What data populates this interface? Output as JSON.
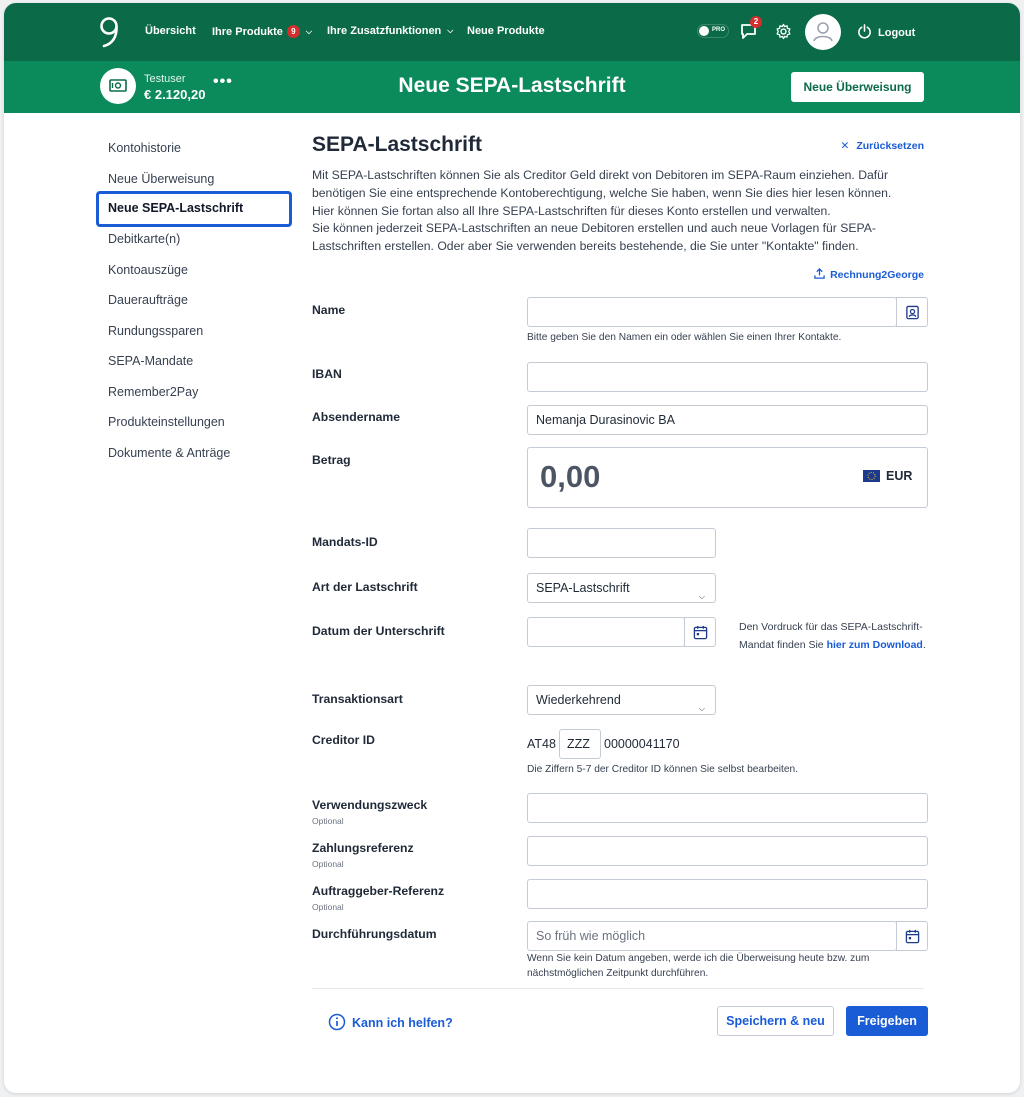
{
  "nav": {
    "items": [
      {
        "label": "Übersicht"
      },
      {
        "label": "Ihre Produkte",
        "badge": "9"
      },
      {
        "label": "Ihre Zusatzfunktionen"
      },
      {
        "label": "Neue Produkte"
      }
    ],
    "pro_label": "PRO",
    "messages_badge": "2",
    "logout_label": "Logout"
  },
  "account": {
    "name": "Testuser",
    "balance": "€ 2.120,20",
    "more": "•••"
  },
  "header": {
    "title": "Neue SEPA-Lastschrift",
    "new_transfer_button": "Neue Überweisung"
  },
  "sidebar": {
    "items": [
      {
        "label": "Kontohistorie"
      },
      {
        "label": "Neue Überweisung"
      },
      {
        "label": "Neue SEPA-Lastschrift",
        "active": true
      },
      {
        "label": "Debitkarte(n)"
      },
      {
        "label": "Kontoauszüge"
      },
      {
        "label": "Daueraufträge"
      },
      {
        "label": "Rundungssparen"
      },
      {
        "label": "SEPA-Mandate"
      },
      {
        "label": "Remember2Pay"
      },
      {
        "label": "Produkteinstellungen"
      },
      {
        "label": "Dokumente & Anträge"
      }
    ]
  },
  "form": {
    "title": "SEPA-Lastschrift",
    "reset_label": "Zurücksetzen",
    "intro_lines": [
      "Mit SEPA-Lastschriften können Sie als Creditor Geld direkt von Debitoren im SEPA-Raum einziehen. Dafür",
      "benötigen Sie eine entsprechende Kontoberechtigung, welche Sie haben, wenn Sie dies hier lesen können.",
      "Hier können Sie fortan also all Ihre SEPA-Lastschriften für dieses Konto erstellen und verwalten.",
      "Sie können jederzeit SEPA-Lastschriften an neue Debitoren erstellen und auch neue Vorlagen für SEPA-",
      "Lastschriften erstellen. Oder aber Sie verwenden bereits bestehende, die Sie unter \"Kontakte\" finden."
    ],
    "r2g_label": "Rechnung2George",
    "name": {
      "label": "Name",
      "value": "",
      "hint": "Bitte geben Sie den Namen ein oder wählen Sie einen Ihrer Kontakte."
    },
    "iban": {
      "label": "IBAN",
      "value": ""
    },
    "sender": {
      "label": "Absendername",
      "value": "Nemanja Durasinovic BA"
    },
    "amount": {
      "label": "Betrag",
      "value": "0,00",
      "currency": "EUR"
    },
    "mandate_id": {
      "label": "Mandats-ID",
      "value": ""
    },
    "debit_type": {
      "label": "Art der Lastschrift",
      "value": "SEPA-Lastschrift"
    },
    "signature_date": {
      "label": "Datum der Unterschrift",
      "value": "",
      "hint_text": "Den Vordruck für das SEPA-Lastschrift-Mandat finden Sie ",
      "hint_link": "hier zum Download",
      "hint_end": "."
    },
    "transaction_type": {
      "label": "Transaktionsart",
      "value": "Wiederkehrend"
    },
    "creditor_id": {
      "label": "Creditor ID",
      "prefix": "AT48",
      "editable": "ZZZ",
      "suffix": "00000041170",
      "hint": "Die Ziffern 5-7 der Creditor ID können Sie selbst bearbeiten."
    },
    "purpose": {
      "label": "Verwendungszweck",
      "optional": "Optional",
      "value": ""
    },
    "payment_ref": {
      "label": "Zahlungsreferenz",
      "optional": "Optional",
      "value": ""
    },
    "client_ref": {
      "label": "Auftraggeber-Referenz",
      "optional": "Optional",
      "value": ""
    },
    "execution_date": {
      "label": "Durchführungsdatum",
      "placeholder": "So früh wie möglich",
      "hint_lines": [
        "Wenn Sie kein Datum angeben, werde ich die Überweisung heute bzw. zum",
        "nächstmöglichen Zeitpunkt durchführen."
      ]
    },
    "help_label": "Kann ich helfen?",
    "save_new_label": "Speichern & neu",
    "release_label": "Freigeben"
  },
  "colors": {
    "nav_bg": "#0b6b49",
    "subheader_bg": "#0b8a5c",
    "accent": "#1a5bd6",
    "badge": "#d32f2f"
  }
}
